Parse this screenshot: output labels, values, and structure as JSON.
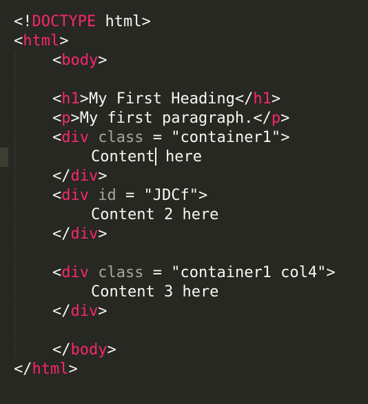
{
  "colors": {
    "background": "#272822",
    "text": "#f8f8f2",
    "tag": "#f92672",
    "attribute": "#a6a69c",
    "string": "#e6db74"
  },
  "code": {
    "doctype_open": "<!",
    "doctype_kw": "DOCTYPE",
    "doctype_rest": " html>",
    "html_open_lt": "<",
    "html_tag": "html",
    "html_open_gt": ">",
    "body_open_lt": "<",
    "body_tag": "body",
    "body_open_gt": ">",
    "h1_open_lt": "<",
    "h1_tag": "h1",
    "h1_open_gt": ">",
    "h1_text": "My First Heading",
    "h1_close_lt": "</",
    "h1_close_tag": "h1",
    "h1_close_gt": ">",
    "p_open_lt": "<",
    "p_tag": "p",
    "p_open_gt": ">",
    "p_text": "My first paragraph.",
    "p_close_lt": "</",
    "p_close_tag": "p",
    "p_close_gt": ">",
    "div1_lt": "<",
    "div1_tag": "div",
    "div1_attr": " class",
    "div1_eq": " = ",
    "div1_val": "\"container1\"",
    "div1_gt": ">",
    "content1_a": "Content",
    "content1_b": " here",
    "div1_close_lt": "</",
    "div1_close_tag": "div",
    "div1_close_gt": ">",
    "div2_lt": "<",
    "div2_tag": "div",
    "div2_attr": " id",
    "div2_eq": " = ",
    "div2_val": "\"JDCf\"",
    "div2_gt": ">",
    "content2": "Content 2 here",
    "div2_close_lt": "</",
    "div2_close_tag": "div",
    "div2_close_gt": ">",
    "div3_lt": "<",
    "div3_tag": "div",
    "div3_attr": " class",
    "div3_eq": " = ",
    "div3_val": "\"container1 col4\"",
    "div3_gt": ">",
    "content3": "Content 3 here",
    "div3_close_lt": "</",
    "div3_close_tag": "div",
    "div3_close_gt": ">",
    "body_close_lt": "</",
    "body_close_tag": "body",
    "body_close_gt": ">",
    "html_close_lt": "</",
    "html_close_tag": "html",
    "html_close_gt": ">"
  }
}
